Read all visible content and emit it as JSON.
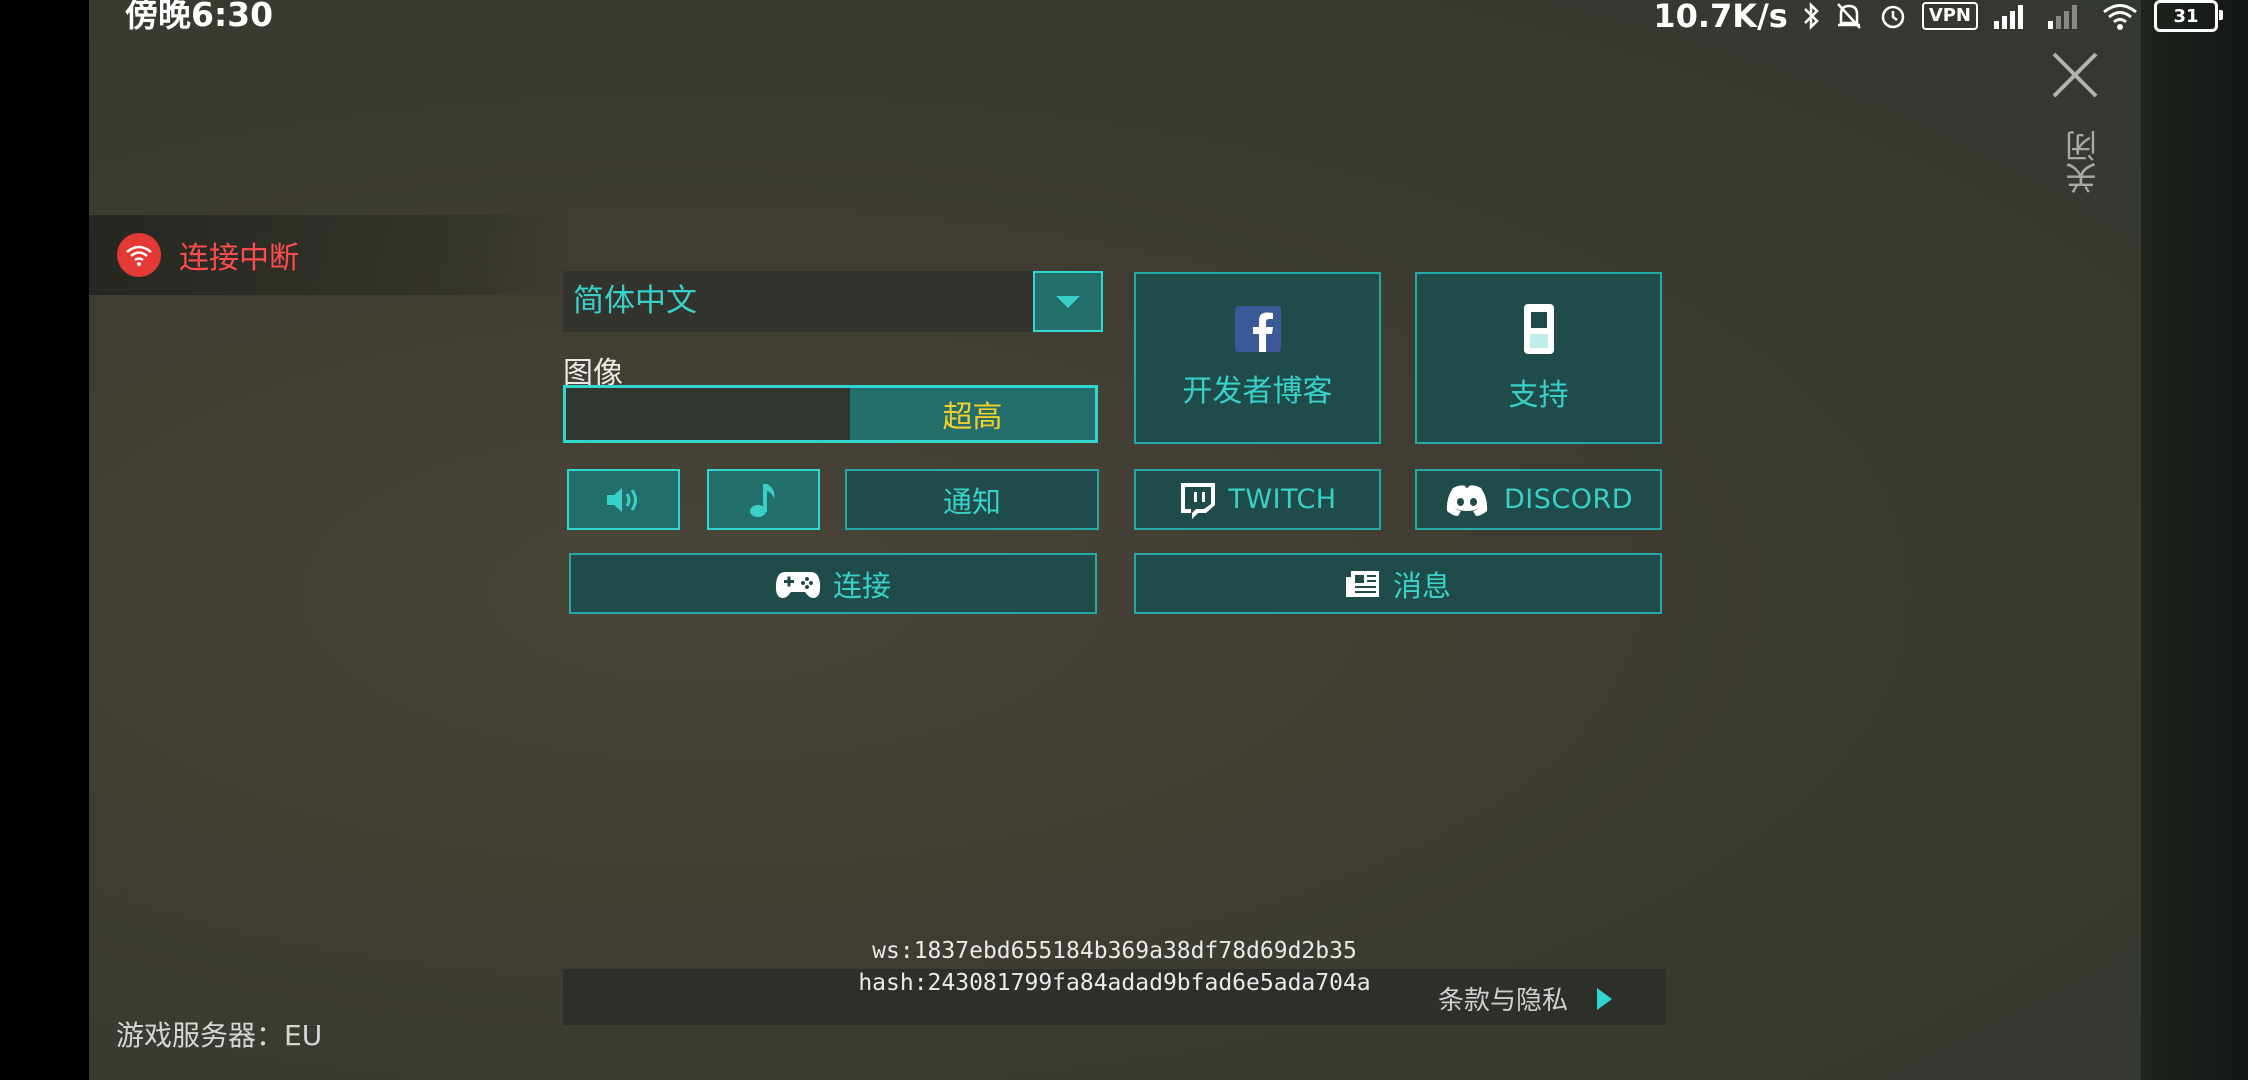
{
  "status_bar": {
    "time": "傍晚6:30",
    "net_speed": "10.7K/s",
    "vpn": "VPN",
    "battery": "31"
  },
  "close": {
    "label": "关闭"
  },
  "connection": {
    "status": "连接中断"
  },
  "settings": {
    "language": "简体中文",
    "graphics_label": "图像",
    "graphics_quality": "超高",
    "notify_label": "通知",
    "connect_label": "连接"
  },
  "links": {
    "dev_blog": "开发者博客",
    "support": "支持",
    "twitch": "TWITCH",
    "discord": "DISCORD",
    "news": "消息"
  },
  "footer": {
    "ws": "ws:1837ebd655184b369a38df78d69d2b35",
    "hash": "hash:243081799fa84adad9bfad6e5ada704a",
    "terms": "条款与隐私",
    "server": "游戏服务器：EU"
  },
  "colors": {
    "teal_text": "#39d0c9",
    "teal_border": "#25a8a6",
    "button_bg": "#1f4b4a",
    "quality_yellow": "#f2cf2a",
    "disconnect_red": "#e53935"
  }
}
